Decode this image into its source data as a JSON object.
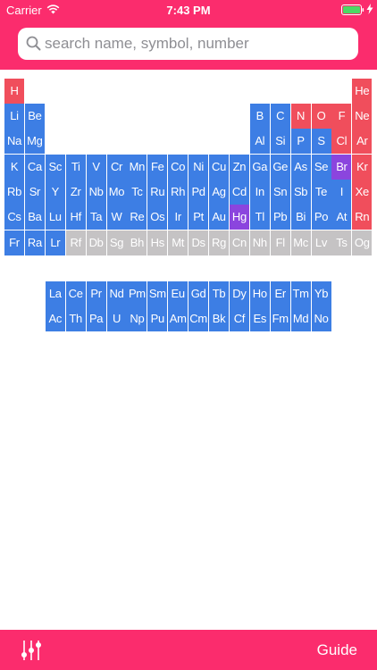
{
  "status_bar": {
    "carrier": "Carrier",
    "time": "7:43 PM"
  },
  "search": {
    "placeholder": "search name, symbol, number"
  },
  "footer": {
    "guide_label": "Guide"
  },
  "colors": {
    "header": "#fb2c6d",
    "blue": "#3d7ee4",
    "red": "#f04e5c",
    "gray": "#c5c3c4",
    "purple": "#8b45de"
  },
  "icons": {
    "search": "search-icon",
    "filter": "sliders-icon",
    "wifi": "wifi-icon",
    "battery": "battery-icon"
  },
  "elements": [
    {
      "s": "H",
      "r": 1,
      "c": 1,
      "t": "red"
    },
    {
      "s": "He",
      "r": 1,
      "c": 18,
      "t": "red"
    },
    {
      "s": "Li",
      "r": 2,
      "c": 1,
      "t": "blue"
    },
    {
      "s": "Be",
      "r": 2,
      "c": 2,
      "t": "blue"
    },
    {
      "s": "B",
      "r": 2,
      "c": 13,
      "t": "blue"
    },
    {
      "s": "C",
      "r": 2,
      "c": 14,
      "t": "blue"
    },
    {
      "s": "N",
      "r": 2,
      "c": 15,
      "t": "red"
    },
    {
      "s": "O",
      "r": 2,
      "c": 16,
      "t": "red"
    },
    {
      "s": "F",
      "r": 2,
      "c": 17,
      "t": "red"
    },
    {
      "s": "Ne",
      "r": 2,
      "c": 18,
      "t": "red"
    },
    {
      "s": "Na",
      "r": 3,
      "c": 1,
      "t": "blue"
    },
    {
      "s": "Mg",
      "r": 3,
      "c": 2,
      "t": "blue"
    },
    {
      "s": "Al",
      "r": 3,
      "c": 13,
      "t": "blue"
    },
    {
      "s": "Si",
      "r": 3,
      "c": 14,
      "t": "blue"
    },
    {
      "s": "P",
      "r": 3,
      "c": 15,
      "t": "blue"
    },
    {
      "s": "S",
      "r": 3,
      "c": 16,
      "t": "blue"
    },
    {
      "s": "Cl",
      "r": 3,
      "c": 17,
      "t": "red"
    },
    {
      "s": "Ar",
      "r": 3,
      "c": 18,
      "t": "red"
    },
    {
      "s": "K",
      "r": 4,
      "c": 1,
      "t": "blue"
    },
    {
      "s": "Ca",
      "r": 4,
      "c": 2,
      "t": "blue"
    },
    {
      "s": "Sc",
      "r": 4,
      "c": 3,
      "t": "blue"
    },
    {
      "s": "Ti",
      "r": 4,
      "c": 4,
      "t": "blue"
    },
    {
      "s": "V",
      "r": 4,
      "c": 5,
      "t": "blue"
    },
    {
      "s": "Cr",
      "r": 4,
      "c": 6,
      "t": "blue"
    },
    {
      "s": "Mn",
      "r": 4,
      "c": 7,
      "t": "blue"
    },
    {
      "s": "Fe",
      "r": 4,
      "c": 8,
      "t": "blue"
    },
    {
      "s": "Co",
      "r": 4,
      "c": 9,
      "t": "blue"
    },
    {
      "s": "Ni",
      "r": 4,
      "c": 10,
      "t": "blue"
    },
    {
      "s": "Cu",
      "r": 4,
      "c": 11,
      "t": "blue"
    },
    {
      "s": "Zn",
      "r": 4,
      "c": 12,
      "t": "blue"
    },
    {
      "s": "Ga",
      "r": 4,
      "c": 13,
      "t": "blue"
    },
    {
      "s": "Ge",
      "r": 4,
      "c": 14,
      "t": "blue"
    },
    {
      "s": "As",
      "r": 4,
      "c": 15,
      "t": "blue"
    },
    {
      "s": "Se",
      "r": 4,
      "c": 16,
      "t": "blue"
    },
    {
      "s": "Br",
      "r": 4,
      "c": 17,
      "t": "purple"
    },
    {
      "s": "Kr",
      "r": 4,
      "c": 18,
      "t": "red"
    },
    {
      "s": "Rb",
      "r": 5,
      "c": 1,
      "t": "blue"
    },
    {
      "s": "Sr",
      "r": 5,
      "c": 2,
      "t": "blue"
    },
    {
      "s": "Y",
      "r": 5,
      "c": 3,
      "t": "blue"
    },
    {
      "s": "Zr",
      "r": 5,
      "c": 4,
      "t": "blue"
    },
    {
      "s": "Nb",
      "r": 5,
      "c": 5,
      "t": "blue"
    },
    {
      "s": "Mo",
      "r": 5,
      "c": 6,
      "t": "blue"
    },
    {
      "s": "Tc",
      "r": 5,
      "c": 7,
      "t": "blue"
    },
    {
      "s": "Ru",
      "r": 5,
      "c": 8,
      "t": "blue"
    },
    {
      "s": "Rh",
      "r": 5,
      "c": 9,
      "t": "blue"
    },
    {
      "s": "Pd",
      "r": 5,
      "c": 10,
      "t": "blue"
    },
    {
      "s": "Ag",
      "r": 5,
      "c": 11,
      "t": "blue"
    },
    {
      "s": "Cd",
      "r": 5,
      "c": 12,
      "t": "blue"
    },
    {
      "s": "In",
      "r": 5,
      "c": 13,
      "t": "blue"
    },
    {
      "s": "Sn",
      "r": 5,
      "c": 14,
      "t": "blue"
    },
    {
      "s": "Sb",
      "r": 5,
      "c": 15,
      "t": "blue"
    },
    {
      "s": "Te",
      "r": 5,
      "c": 16,
      "t": "blue"
    },
    {
      "s": "I",
      "r": 5,
      "c": 17,
      "t": "blue"
    },
    {
      "s": "Xe",
      "r": 5,
      "c": 18,
      "t": "red"
    },
    {
      "s": "Cs",
      "r": 6,
      "c": 1,
      "t": "blue"
    },
    {
      "s": "Ba",
      "r": 6,
      "c": 2,
      "t": "blue"
    },
    {
      "s": "Lu",
      "r": 6,
      "c": 3,
      "t": "blue"
    },
    {
      "s": "Hf",
      "r": 6,
      "c": 4,
      "t": "blue"
    },
    {
      "s": "Ta",
      "r": 6,
      "c": 5,
      "t": "blue"
    },
    {
      "s": "W",
      "r": 6,
      "c": 6,
      "t": "blue"
    },
    {
      "s": "Re",
      "r": 6,
      "c": 7,
      "t": "blue"
    },
    {
      "s": "Os",
      "r": 6,
      "c": 8,
      "t": "blue"
    },
    {
      "s": "Ir",
      "r": 6,
      "c": 9,
      "t": "blue"
    },
    {
      "s": "Pt",
      "r": 6,
      "c": 10,
      "t": "blue"
    },
    {
      "s": "Au",
      "r": 6,
      "c": 11,
      "t": "blue"
    },
    {
      "s": "Hg",
      "r": 6,
      "c": 12,
      "t": "purple"
    },
    {
      "s": "Tl",
      "r": 6,
      "c": 13,
      "t": "blue"
    },
    {
      "s": "Pb",
      "r": 6,
      "c": 14,
      "t": "blue"
    },
    {
      "s": "Bi",
      "r": 6,
      "c": 15,
      "t": "blue"
    },
    {
      "s": "Po",
      "r": 6,
      "c": 16,
      "t": "blue"
    },
    {
      "s": "At",
      "r": 6,
      "c": 17,
      "t": "blue"
    },
    {
      "s": "Rn",
      "r": 6,
      "c": 18,
      "t": "red"
    },
    {
      "s": "Fr",
      "r": 7,
      "c": 1,
      "t": "blue"
    },
    {
      "s": "Ra",
      "r": 7,
      "c": 2,
      "t": "blue"
    },
    {
      "s": "Lr",
      "r": 7,
      "c": 3,
      "t": "blue"
    },
    {
      "s": "Rf",
      "r": 7,
      "c": 4,
      "t": "gray"
    },
    {
      "s": "Db",
      "r": 7,
      "c": 5,
      "t": "gray"
    },
    {
      "s": "Sg",
      "r": 7,
      "c": 6,
      "t": "gray"
    },
    {
      "s": "Bh",
      "r": 7,
      "c": 7,
      "t": "gray"
    },
    {
      "s": "Hs",
      "r": 7,
      "c": 8,
      "t": "gray"
    },
    {
      "s": "Mt",
      "r": 7,
      "c": 9,
      "t": "gray"
    },
    {
      "s": "Ds",
      "r": 7,
      "c": 10,
      "t": "gray"
    },
    {
      "s": "Rg",
      "r": 7,
      "c": 11,
      "t": "gray"
    },
    {
      "s": "Cn",
      "r": 7,
      "c": 12,
      "t": "gray"
    },
    {
      "s": "Nh",
      "r": 7,
      "c": 13,
      "t": "gray"
    },
    {
      "s": "Fl",
      "r": 7,
      "c": 14,
      "t": "gray"
    },
    {
      "s": "Mc",
      "r": 7,
      "c": 15,
      "t": "gray"
    },
    {
      "s": "Lv",
      "r": 7,
      "c": 16,
      "t": "gray"
    },
    {
      "s": "Ts",
      "r": 7,
      "c": 17,
      "t": "gray"
    },
    {
      "s": "Og",
      "r": 7,
      "c": 18,
      "t": "gray"
    },
    {
      "s": "La",
      "r": 8,
      "c": 3,
      "t": "blue"
    },
    {
      "s": "Ce",
      "r": 8,
      "c": 4,
      "t": "blue"
    },
    {
      "s": "Pr",
      "r": 8,
      "c": 5,
      "t": "blue"
    },
    {
      "s": "Nd",
      "r": 8,
      "c": 6,
      "t": "blue"
    },
    {
      "s": "Pm",
      "r": 8,
      "c": 7,
      "t": "blue"
    },
    {
      "s": "Sm",
      "r": 8,
      "c": 8,
      "t": "blue"
    },
    {
      "s": "Eu",
      "r": 8,
      "c": 9,
      "t": "blue"
    },
    {
      "s": "Gd",
      "r": 8,
      "c": 10,
      "t": "blue"
    },
    {
      "s": "Tb",
      "r": 8,
      "c": 11,
      "t": "blue"
    },
    {
      "s": "Dy",
      "r": 8,
      "c": 12,
      "t": "blue"
    },
    {
      "s": "Ho",
      "r": 8,
      "c": 13,
      "t": "blue"
    },
    {
      "s": "Er",
      "r": 8,
      "c": 14,
      "t": "blue"
    },
    {
      "s": "Tm",
      "r": 8,
      "c": 15,
      "t": "blue"
    },
    {
      "s": "Yb",
      "r": 8,
      "c": 16,
      "t": "blue"
    },
    {
      "s": "Ac",
      "r": 9,
      "c": 3,
      "t": "blue"
    },
    {
      "s": "Th",
      "r": 9,
      "c": 4,
      "t": "blue"
    },
    {
      "s": "Pa",
      "r": 9,
      "c": 5,
      "t": "blue"
    },
    {
      "s": "U",
      "r": 9,
      "c": 6,
      "t": "blue"
    },
    {
      "s": "Np",
      "r": 9,
      "c": 7,
      "t": "blue"
    },
    {
      "s": "Pu",
      "r": 9,
      "c": 8,
      "t": "blue"
    },
    {
      "s": "Am",
      "r": 9,
      "c": 9,
      "t": "blue"
    },
    {
      "s": "Cm",
      "r": 9,
      "c": 10,
      "t": "blue"
    },
    {
      "s": "Bk",
      "r": 9,
      "c": 11,
      "t": "blue"
    },
    {
      "s": "Cf",
      "r": 9,
      "c": 12,
      "t": "blue"
    },
    {
      "s": "Es",
      "r": 9,
      "c": 13,
      "t": "blue"
    },
    {
      "s": "Fm",
      "r": 9,
      "c": 14,
      "t": "blue"
    },
    {
      "s": "Md",
      "r": 9,
      "c": 15,
      "t": "blue"
    },
    {
      "s": "No",
      "r": 9,
      "c": 16,
      "t": "blue"
    }
  ]
}
